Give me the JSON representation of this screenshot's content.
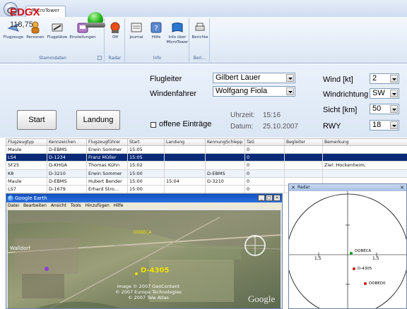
{
  "ribbon": {
    "tab": "MicroTower",
    "groups": [
      {
        "title": "Stammdaten",
        "buttons": [
          "Flugzeuge",
          "Personen",
          "Flugplätze",
          "Einstellungen"
        ]
      },
      {
        "title": "Radar",
        "buttons": [
          "Off"
        ]
      },
      {
        "title": "Info",
        "buttons": [
          "Journal",
          "Hilfe",
          "Info über MicroTower"
        ]
      },
      {
        "title": "Beri...",
        "buttons": [
          "Berichte"
        ]
      }
    ]
  },
  "airfield": {
    "code": "EDGX",
    "frequency": "118,75"
  },
  "controls": {
    "start": "Start",
    "landing": "Landung",
    "offene_label": "offene Einträge"
  },
  "staff": {
    "flugleiter_label": "Flugleiter",
    "flugleiter_value": "Gilbert Lauer",
    "windenfahrer_label": "Windenfahrer",
    "windenfahrer_value": "Wolfgang Fiola"
  },
  "clock": {
    "uhrzeit_label": "Uhrzeit:",
    "uhrzeit": "15:16",
    "datum_label": "Datum:",
    "datum": "25.10.2007"
  },
  "weather": {
    "wind_label": "Wind [kt]",
    "wind": "2",
    "richtung_label": "Windrichtung",
    "richtung": "SW",
    "sicht_label": "Sicht [km]",
    "sicht": "50",
    "rwy_label": "RWY",
    "rwy": "18"
  },
  "table": {
    "columns": [
      "Flugzeugtyp",
      "Kennzeichen",
      "Flugzeugführer",
      "Start",
      "Landung",
      "KennungSchlepp",
      "TaG",
      "Begleiter",
      "Bemerkung"
    ],
    "rows": [
      [
        "Maule",
        "D-EBMS",
        "Erwin Sommer",
        "15:05",
        "",
        "",
        "0",
        "",
        ""
      ],
      [
        "LS4",
        "D-1234",
        "Franz Müller",
        "15:05",
        "",
        "",
        "0",
        "",
        ""
      ],
      [
        "SF25",
        "D-KHGA",
        "Thomas Kühn",
        "15:02",
        "",
        "",
        "0",
        "",
        "Ziel: Hockenheim;"
      ],
      [
        "K8",
        "D-3210",
        "Erwin Sommer",
        "15:00",
        "",
        "D-EBMS",
        "0",
        "",
        ""
      ],
      [
        "Maule",
        "D-EBMS",
        "Hubert Bender",
        "15:00",
        "15:04",
        "D-3210",
        "0",
        "",
        ""
      ],
      [
        "LS7",
        "D-1679",
        "Erhard Stro...",
        "15:00",
        "",
        "",
        "0",
        "",
        ""
      ]
    ]
  },
  "google_earth": {
    "title": "Google Earth",
    "menu": [
      "Datei",
      "Bearbeiten",
      "Ansicht",
      "Tools",
      "Hinzufügen",
      "Hilfe"
    ],
    "place": "Walldorf",
    "marker1": "DDBECA",
    "marker2": "D-4305",
    "copyright1": "Image © 2007 GeoContent",
    "copyright2": "© 2007 Europa Technologies",
    "copyright3": "© 2007 Tele Atlas",
    "logo": "Google"
  },
  "radar": {
    "title": "Radar",
    "scale_left": "1,5",
    "scale_right": "1,5",
    "targets": [
      "DDBECA",
      "D-4305",
      "DDBED0"
    ]
  },
  "colors": {
    "selected_row": "#0a2a78",
    "airfield": "#d0101a",
    "led": "#21b81b"
  }
}
